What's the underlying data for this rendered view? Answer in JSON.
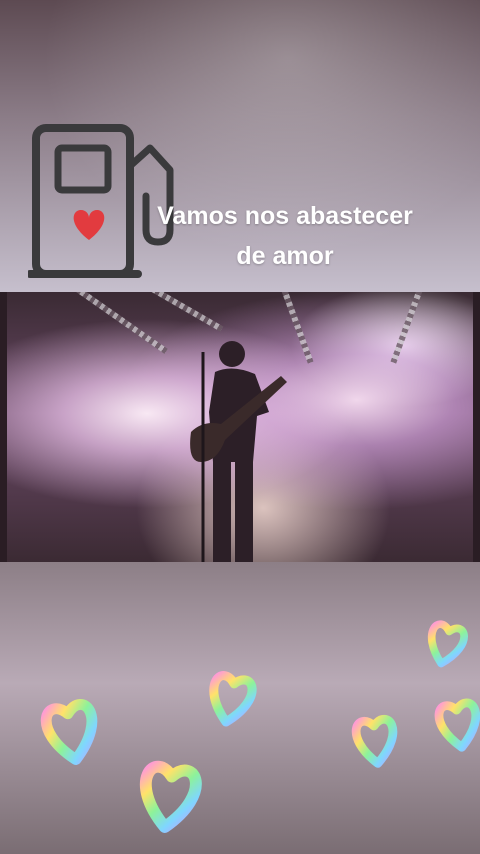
{
  "story": {
    "caption_line1": "Vamos nos abastecer",
    "caption_line2": "de amor",
    "icons": {
      "fuel_pump": "fuel-pump-heart-icon",
      "sticker": "rainbow-heart-sticker"
    },
    "colors": {
      "heart_red": "#e23b3f",
      "pump_outline": "#3a3a3c",
      "caption_text": "#ffffff"
    }
  }
}
